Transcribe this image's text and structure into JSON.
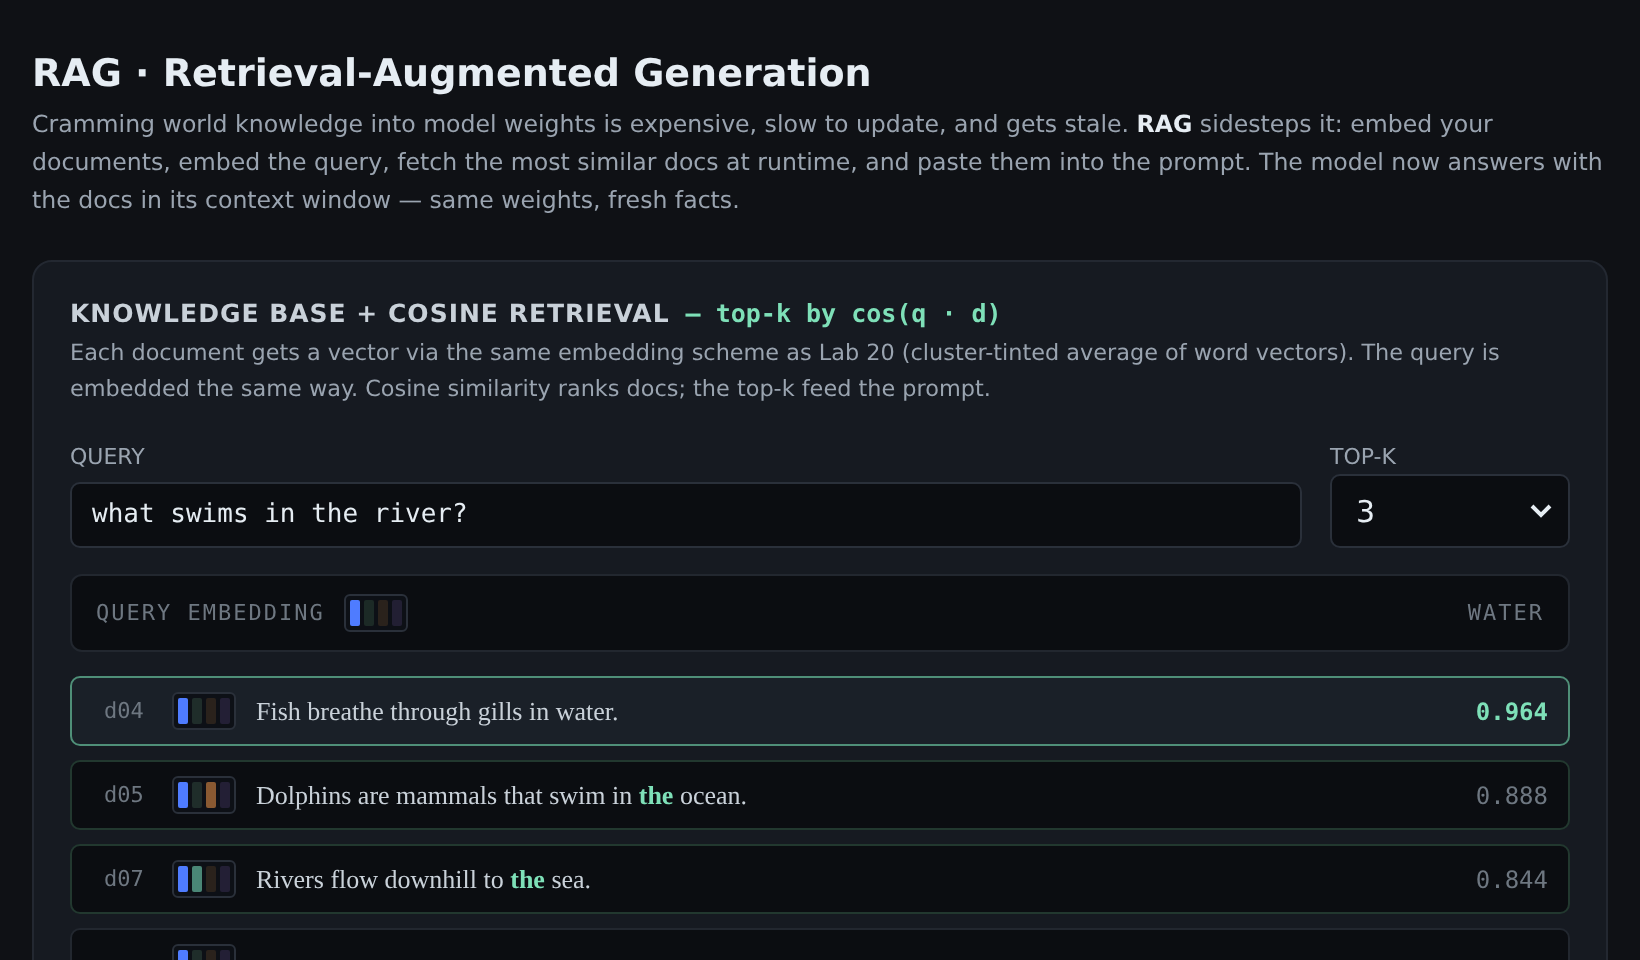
{
  "title": "RAG · Retrieval-Augmented Generation",
  "intro": "Cramming world knowledge into model weights is expensive, slow to update, and gets stale. **RAG** sidesteps it: embed your documents, embed the query, fetch the most similar docs at runtime, and paste them into the prompt. The model now answers with the docs in its context window — same weights, fresh facts.",
  "panel": {
    "heading": "KNOWLEDGE BASE + COSINE RETRIEVAL",
    "formula": "— top-k by cos(q · d)",
    "description": "Each document gets a vector via the same embedding scheme as Lab 20 (cluster-tinted average of word vectors). The query is embedded the same way. Cosine similarity ranks docs; the top-k feed the prompt.",
    "query": {
      "label": "QUERY",
      "value": "what swims in the river?"
    },
    "top_k": {
      "label": "TOP-K",
      "value": "3"
    },
    "query_embedding": {
      "label": "QUERY EMBEDDING",
      "cluster": "WATER",
      "embedding": [
        {
          "color": "#4f7cff"
        },
        {
          "color": "#1c2a26"
        },
        {
          "color": "#2a221c"
        },
        {
          "color": "#221f33"
        }
      ]
    },
    "documents": [
      {
        "id": "d04",
        "text": "Fish breathe through gills in water.",
        "score": "0.964",
        "selected": true,
        "top_k": true,
        "embedding": [
          {
            "color": "#4f7cff"
          },
          {
            "color": "#1f2d2a"
          },
          {
            "color": "#2a221c"
          },
          {
            "color": "#231f35"
          }
        ]
      },
      {
        "id": "d05",
        "text": "Dolphins are mammals that swim in **the** ocean.",
        "score": "0.888",
        "selected": false,
        "top_k": true,
        "embedding": [
          {
            "color": "#4f7cff"
          },
          {
            "color": "#1f2d2a"
          },
          {
            "color": "#8a5a32"
          },
          {
            "color": "#231f35"
          }
        ]
      },
      {
        "id": "d07",
        "text": "Rivers flow downhill to **the** sea.",
        "score": "0.844",
        "selected": false,
        "top_k": true,
        "embedding": [
          {
            "color": "#4f7cff"
          },
          {
            "color": "#4a8676"
          },
          {
            "color": "#2a221c"
          },
          {
            "color": "#231f35"
          }
        ]
      },
      {
        "selected": false,
        "top_k": false,
        "embedding": [
          {
            "color": "#4f7cff"
          },
          {
            "color": "#1f2d2a"
          },
          {
            "color": "#2a221c"
          },
          {
            "color": "#231f35"
          }
        ]
      }
    ]
  }
}
